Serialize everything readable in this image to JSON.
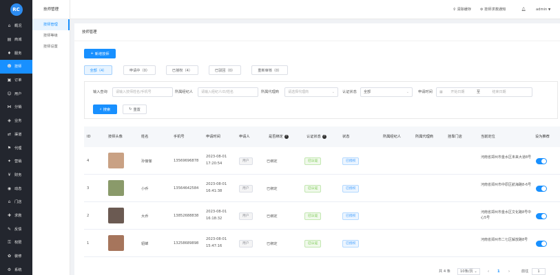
{
  "sidebar": {
    "logo": "RC",
    "items": [
      {
        "label": "概况",
        "icon": "home-icon"
      },
      {
        "label": "商城",
        "icon": "shop-icon"
      },
      {
        "label": "服务",
        "icon": "service-icon"
      },
      {
        "label": "技师",
        "icon": "technician-icon"
      },
      {
        "label": "订单",
        "icon": "order-icon"
      },
      {
        "label": "用户",
        "icon": "user-icon"
      },
      {
        "label": "分销",
        "icon": "distribution-icon"
      },
      {
        "label": "业务",
        "icon": "business-icon"
      },
      {
        "label": "渠道",
        "icon": "channel-icon"
      },
      {
        "label": "代理",
        "icon": "agent-icon"
      },
      {
        "label": "营销",
        "icon": "marketing-icon"
      },
      {
        "label": "财务",
        "icon": "finance-icon"
      },
      {
        "label": "动态",
        "icon": "feed-icon"
      },
      {
        "label": "门店",
        "icon": "store-icon"
      },
      {
        "label": "求救",
        "icon": "sos-icon"
      },
      {
        "label": "反馈",
        "icon": "feedback-icon"
      },
      {
        "label": "权限",
        "icon": "permission-icon"
      },
      {
        "label": "装修",
        "icon": "decorate-icon"
      },
      {
        "label": "系统",
        "icon": "system-icon"
      }
    ],
    "active_index": 3
  },
  "submenu": {
    "title": "技师管理",
    "items": [
      "技师管理",
      "技师等级",
      "技师设置"
    ]
  },
  "topbar": {
    "clear_cache": "清除缓存",
    "notice": "技师求救通知",
    "user": "admin"
  },
  "breadcrumb": "技师管理",
  "add_button": "新增技师",
  "tabs": [
    {
      "label": "全部（4）"
    },
    {
      "label": "申请中（0）"
    },
    {
      "label": "已授权（4）"
    },
    {
      "label": "已驳回（0）"
    },
    {
      "label": "重新审核（0）"
    }
  ],
  "filters": {
    "query_label": "输入查询",
    "query_placeholder": "请输入技师姓名/手机号",
    "broker_label": "所属经纪人",
    "broker_placeholder": "请输入经纪人ID/姓名",
    "agent_label": "所属代理商",
    "agent_placeholder": "请选择代理商",
    "auth_label": "认证状态",
    "auth_value": "全部",
    "time_label": "申请时间",
    "start_placeholder": "开始日期",
    "to": "至",
    "end_placeholder": "结束日期",
    "search_button": "搜索",
    "reset_button": "重置"
  },
  "table": {
    "headers": {
      "id": "ID",
      "avatar": "技师头像",
      "name": "姓名",
      "phone": "手机号",
      "apply_time": "申请时间",
      "applicant": "申请人",
      "bound": "是否绑定",
      "auth": "认证状态",
      "status": "状态",
      "broker": "所属经纪人",
      "agent": "所属代理商",
      "store": "挂靠门店",
      "location": "当前定位",
      "recommend": "设为推荐"
    },
    "rows": [
      {
        "id": "4",
        "name": "孙俪俪",
        "phone": "13569696878",
        "date": "2023-08-01",
        "time": "17:20:54",
        "applicant": "用户",
        "bound": "已绑定",
        "auth": "已认证",
        "status": "已授权",
        "location": "河南省郑州市金水区未来大道8号",
        "recommend": true,
        "avatar_color": "#c9a184"
      },
      {
        "id": "3",
        "name": "小乔",
        "phone": "13564642584",
        "date": "2023-08-01",
        "time": "16:41:38",
        "applicant": "用户",
        "bound": "已绑定",
        "auth": "已认证",
        "status": "已授权",
        "location": "河南省郑州市中原区航海路8-6号",
        "recommend": true,
        "avatar_color": "#8a9a6a"
      },
      {
        "id": "2",
        "name": "大乔",
        "phone": "13852688838",
        "date": "2023-08-01",
        "time": "16:18:32",
        "applicant": "用户",
        "bound": "已绑定",
        "auth": "已认证",
        "status": "已授权",
        "location": "河南省郑州市金水区文化路8号中心5号",
        "recommend": true,
        "avatar_color": "#6b5a52"
      },
      {
        "id": "1",
        "name": "貂蝉",
        "phone": "13258689898",
        "date": "2023-08-01",
        "time": "15:47:16",
        "applicant": "用户",
        "bound": "已绑定",
        "auth": "已认证",
        "status": "已授权",
        "location": "河南省郑州市二七区解放路8号",
        "recommend": true,
        "avatar_color": "#a6755c"
      }
    ]
  },
  "pagination": {
    "total": "共 4 条",
    "page_size": "10条/页",
    "current": "1",
    "goto_label": "前往",
    "goto_value": "1"
  }
}
